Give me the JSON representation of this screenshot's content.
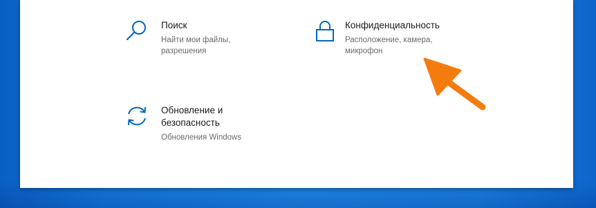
{
  "tiles": {
    "search": {
      "title": "Поиск",
      "desc_line1": "Найти мои файлы,",
      "desc_line2": "разрешения",
      "icon": "search-icon"
    },
    "privacy": {
      "title": "Конфиденциальность",
      "desc_line1": "Расположение, камера,",
      "desc_line2": "микрофон",
      "icon": "lock-icon"
    },
    "update": {
      "title_line1": "Обновление и",
      "title_line2": "безопасность",
      "desc": "Обновления Windows",
      "icon": "sync-icon"
    }
  },
  "colors": {
    "accent": "#0067c0",
    "annotation_arrow": "#f47c0f",
    "desktop": "#1a80e2"
  }
}
